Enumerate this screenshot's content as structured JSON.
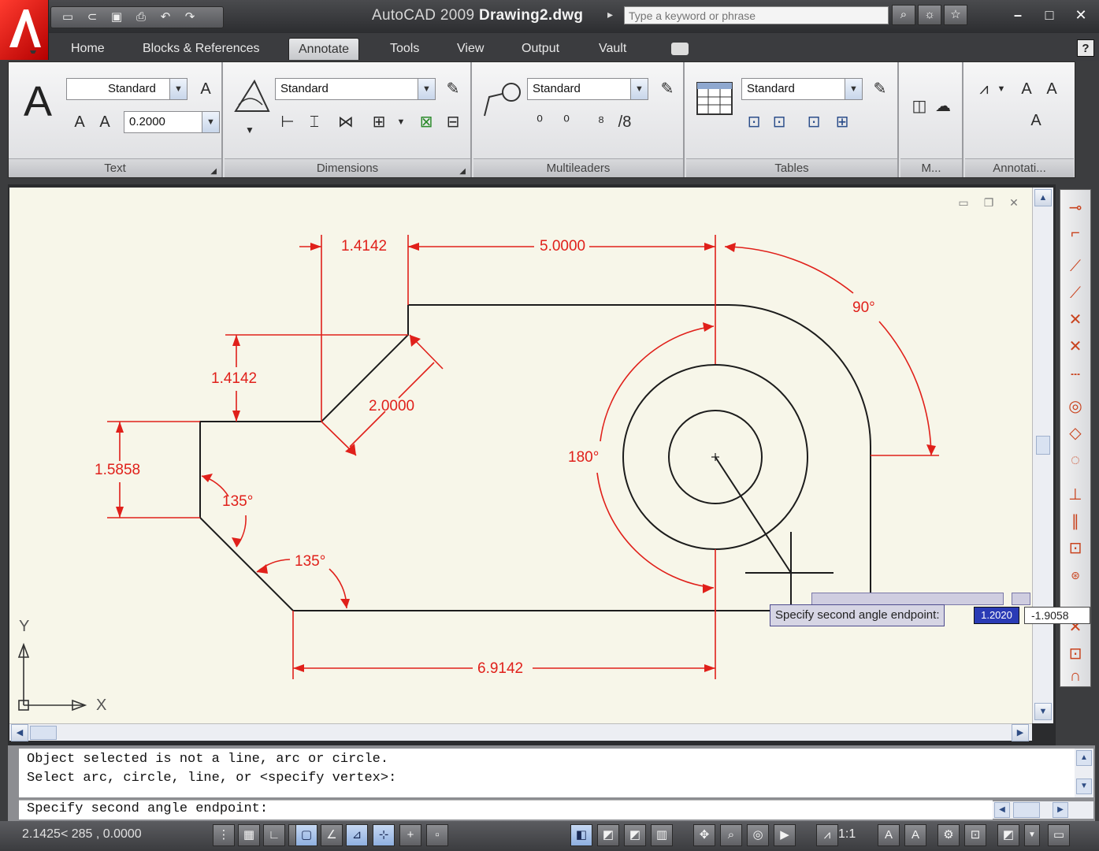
{
  "titlebar": {
    "app_name": "AutoCAD 2009",
    "file_name": "Drawing2.dwg",
    "search_placeholder": "Type a keyword or phrase"
  },
  "ribbon_tabs": [
    "Home",
    "Blocks & References",
    "Annotate",
    "Tools",
    "View",
    "Output",
    "Vault"
  ],
  "active_tab": "Annotate",
  "panels": {
    "text": {
      "title": "Text",
      "style": "Standard",
      "height": "0.2000"
    },
    "dimensions": {
      "title": "Dimensions",
      "style": "Standard"
    },
    "multileaders": {
      "title": "Multileaders",
      "style": "Standard"
    },
    "tables": {
      "title": "Tables",
      "style": "Standard"
    },
    "markup": {
      "title": "M..."
    },
    "annotation_scaling": {
      "title": "Annotati..."
    }
  },
  "drawing": {
    "dims": {
      "d1": "1.4142",
      "d2": "5.0000",
      "d3": "1.4142",
      "d4": "2.0000",
      "d5": "1.5858",
      "d6": "6.9142"
    },
    "angles": {
      "a1": "90°",
      "a2": "180°",
      "a3": "135°",
      "a4": "135°"
    },
    "ucs": {
      "x": "X",
      "y": "Y"
    }
  },
  "dynamic_input": {
    "prompt": "Specify second angle endpoint:",
    "value1": "1.2020",
    "value2": "-1.9058"
  },
  "command_line": {
    "history": [
      "Object selected is not a line, arc or circle.",
      "Select arc, circle, line, or <specify vertex>:"
    ],
    "current": "Specify second angle endpoint:"
  },
  "statusbar": {
    "coords": "2.1425<  285  , 0.0000",
    "scale": "1:1"
  },
  "colors": {
    "canvas": "#f7f6e9",
    "dimension": "#e0201a",
    "geometry": "#1c1c1c",
    "accent": "#e8261b"
  }
}
